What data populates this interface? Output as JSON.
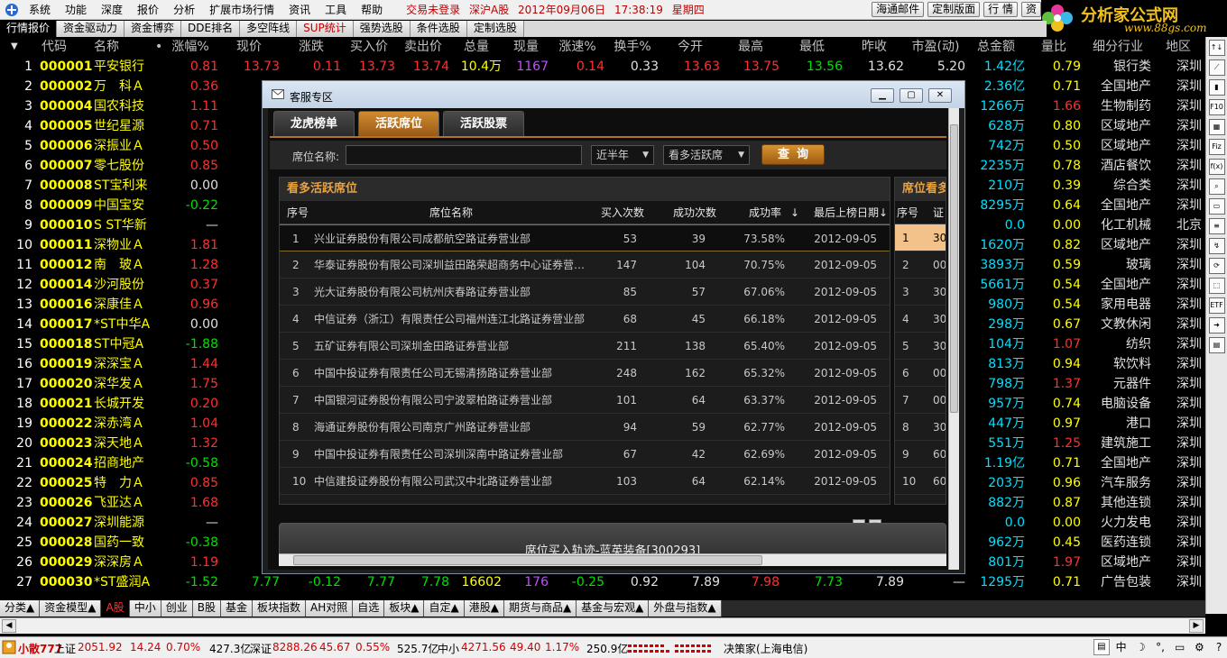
{
  "menubar": {
    "items": [
      "系统",
      "功能",
      "深度",
      "报价",
      "分析",
      "扩展市场行情",
      "资讯",
      "工具",
      "帮助"
    ],
    "status": [
      "交易未登录",
      "深沪A股",
      "2012年09月06日",
      "17:38:19",
      "星期四"
    ],
    "buttons": [
      "海通邮件",
      "定制版面",
      "行 情",
      "资"
    ]
  },
  "brand": {
    "title": "分析家公式网",
    "url": "www.88gs.com"
  },
  "toptabs": [
    {
      "label": "行情报价",
      "state": "active"
    },
    {
      "label": "资金驱动力",
      "state": ""
    },
    {
      "label": "资金博弈",
      "state": ""
    },
    {
      "label": "DDE排名",
      "state": ""
    },
    {
      "label": "多空阵线",
      "state": ""
    },
    {
      "label": "SUP统计",
      "state": "red"
    },
    {
      "label": "强势选股",
      "state": ""
    },
    {
      "label": "条件选股",
      "state": ""
    },
    {
      "label": "定制选股",
      "state": ""
    }
  ],
  "grid": {
    "headers": [
      "代码",
      "名称",
      "•",
      "涨幅%",
      "现价",
      "涨跌",
      "买入价",
      "卖出价",
      "总量",
      "现量",
      "涨速%",
      "换手%",
      "今开",
      "最高",
      "最低",
      "昨收",
      "市盈(动)",
      "总金额",
      "量比",
      "细分行业",
      "地区"
    ],
    "sort_icon": "▼",
    "rows": [
      [
        "1",
        "000001",
        "平安银行",
        "0.81",
        "13.73",
        "0.11",
        "13.73",
        "13.74",
        "10.4万",
        "1167",
        "0.14",
        "0.33",
        "13.63",
        "13.75",
        "13.56",
        "13.62",
        "5.20",
        "1.42亿",
        "0.79",
        "银行类",
        "深圳"
      ],
      [
        "2",
        "000002",
        "万　科Ａ",
        "0.36",
        "8",
        "",
        "",
        "",
        "",
        "",
        "",
        "",
        "",
        "",
        "",
        "",
        "",
        "2.36亿",
        "0.71",
        "全国地产",
        "深圳"
      ],
      [
        "3",
        "000004",
        "国农科技",
        "1.11",
        "8",
        "",
        "",
        "",
        "",
        "",
        "",
        "",
        "",
        "",
        "",
        "",
        "",
        "1266万",
        "1.66",
        "生物制药",
        "深圳"
      ],
      [
        "4",
        "000005",
        "世纪星源",
        "0.71",
        "2",
        "",
        "",
        "",
        "",
        "",
        "",
        "",
        "",
        "",
        "",
        "",
        "",
        "628万",
        "0.80",
        "区域地产",
        "深圳"
      ],
      [
        "5",
        "000006",
        "深振业Ａ",
        "0.50",
        "4",
        "",
        "",
        "",
        "",
        "",
        "",
        "",
        "",
        "",
        "",
        "",
        "",
        "742万",
        "0.50",
        "区域地产",
        "深圳"
      ],
      [
        "6",
        "000007",
        "零七股份",
        "0.85",
        "16",
        "",
        "",
        "",
        "",
        "",
        "",
        "",
        "",
        "",
        "",
        "",
        "",
        "2235万",
        "0.78",
        "酒店餐饮",
        "深圳"
      ],
      [
        "7",
        "000008",
        "ST宝利来",
        "0.00",
        "10",
        "",
        "",
        "",
        "",
        "",
        "",
        "",
        "",
        "",
        "",
        "",
        "",
        "210万",
        "0.39",
        "综合类",
        "深圳"
      ],
      [
        "8",
        "000009",
        "中国宝安",
        "-0.22",
        "8",
        "",
        "",
        "",
        "",
        "",
        "",
        "",
        "",
        "",
        "",
        "",
        "",
        "8295万",
        "0.64",
        "全国地产",
        "深圳"
      ],
      [
        "9",
        "000010",
        "S ST华新",
        "—",
        "",
        "",
        "",
        "",
        "",
        "",
        "",
        "",
        "",
        "",
        "",
        "",
        "",
        "0.0",
        "0.00",
        "化工机械",
        "北京"
      ],
      [
        "10",
        "000011",
        "深物业Ａ",
        "1.81",
        "6",
        "",
        "",
        "",
        "",
        "",
        "",
        "",
        "",
        "",
        "",
        "",
        "",
        "1620万",
        "0.82",
        "区域地产",
        "深圳"
      ],
      [
        "11",
        "000012",
        "南　玻Ａ",
        "1.28",
        "7",
        "",
        "",
        "",
        "",
        "",
        "",
        "",
        "",
        "",
        "",
        "",
        "",
        "3893万",
        "0.59",
        "玻璃",
        "深圳"
      ],
      [
        "12",
        "000014",
        "沙河股份",
        "0.37",
        "8",
        "",
        "",
        "",
        "",
        "",
        "",
        "",
        "",
        "",
        "",
        "",
        "",
        "5661万",
        "0.54",
        "全国地产",
        "深圳"
      ],
      [
        "13",
        "000016",
        "深康佳Ａ",
        "0.96",
        "3",
        "",
        "",
        "",
        "",
        "",
        "",
        "",
        "",
        "",
        "",
        "",
        "",
        "980万",
        "0.54",
        "家用电器",
        "深圳"
      ],
      [
        "14",
        "000017",
        "*ST中华A",
        "0.00",
        "3",
        "",
        "",
        "",
        "",
        "",
        "",
        "",
        "",
        "",
        "",
        "",
        "",
        "298万",
        "0.67",
        "文教休闲",
        "深圳"
      ],
      [
        "15",
        "000018",
        "ST中冠A",
        "-1.88",
        "5",
        "",
        "",
        "",
        "",
        "",
        "",
        "",
        "",
        "",
        "",
        "",
        "",
        "104万",
        "1.07",
        "纺织",
        "深圳"
      ],
      [
        "16",
        "000019",
        "深深宝Ａ",
        "1.44",
        "8",
        "",
        "",
        "",
        "",
        "",
        "",
        "",
        "",
        "",
        "",
        "",
        "",
        "813万",
        "0.94",
        "软饮料",
        "深圳"
      ],
      [
        "17",
        "000020",
        "深华发Ａ",
        "1.75",
        "6",
        "",
        "",
        "",
        "",
        "",
        "",
        "",
        "",
        "",
        "",
        "",
        "",
        "798万",
        "1.37",
        "元器件",
        "深圳"
      ],
      [
        "18",
        "000021",
        "长城开发",
        "0.20",
        "4",
        "",
        "",
        "",
        "",
        "",
        "",
        "",
        "",
        "",
        "",
        "",
        "",
        "957万",
        "0.74",
        "电脑设备",
        "深圳"
      ],
      [
        "19",
        "000022",
        "深赤湾Ａ",
        "1.04",
        "8",
        "",
        "",
        "",
        "",
        "",
        "",
        "",
        "",
        "",
        "",
        "",
        "",
        "447万",
        "0.97",
        "港口",
        "深圳"
      ],
      [
        "20",
        "000023",
        "深天地Ａ",
        "1.32",
        "6",
        "",
        "",
        "",
        "",
        "",
        "",
        "",
        "",
        "",
        "",
        "",
        "",
        "551万",
        "1.25",
        "建筑施工",
        "深圳"
      ],
      [
        "21",
        "000024",
        "招商地产",
        "-0.58",
        "20",
        "",
        "",
        "",
        "",
        "",
        "",
        "",
        "",
        "",
        "",
        "",
        "",
        "1.19亿",
        "0.71",
        "全国地产",
        "深圳"
      ],
      [
        "22",
        "000025",
        "特　力Ａ",
        "0.85",
        "5",
        "",
        "",
        "",
        "",
        "",
        "",
        "",
        "",
        "",
        "",
        "",
        "",
        "203万",
        "0.96",
        "汽车服务",
        "深圳"
      ],
      [
        "23",
        "000026",
        "飞亚达Ａ",
        "1.68",
        "8",
        "",
        "",
        "",
        "",
        "",
        "",
        "",
        "",
        "",
        "",
        "",
        "",
        "882万",
        "0.87",
        "其他连锁",
        "深圳"
      ],
      [
        "24",
        "000027",
        "深圳能源",
        "—",
        "",
        "",
        "",
        "",
        "",
        "",
        "",
        "",
        "",
        "",
        "",
        "",
        "",
        "0.0",
        "0.00",
        "火力发电",
        "深圳"
      ],
      [
        "25",
        "000028",
        "国药一致",
        "-0.38",
        "33",
        "",
        "",
        "",
        "",
        "",
        "",
        "",
        "",
        "",
        "",
        "",
        "",
        "962万",
        "0.45",
        "医药连锁",
        "深圳"
      ],
      [
        "26",
        "000029",
        "深深房Ａ",
        "1.19",
        "3",
        "",
        "",
        "",
        "",
        "",
        "",
        "",
        "",
        "",
        "",
        "",
        "",
        "801万",
        "1.97",
        "区域地产",
        "深圳"
      ],
      [
        "27",
        "000030",
        "*ST盛润A",
        "-1.52",
        "7.77",
        "-0.12",
        "7.77",
        "7.78",
        "16602",
        "176",
        "-0.25",
        "0.92",
        "7.89",
        "7.98",
        "7.73",
        "7.89",
        "—",
        "1295万",
        "0.71",
        "广告包装",
        "深圳"
      ]
    ]
  },
  "righttools": [
    "F10",
    "Fiz",
    "f(x)",
    "ETF"
  ],
  "bottabs": [
    {
      "label": "分类▲",
      "state": ""
    },
    {
      "label": "资金模型▲",
      "state": ""
    },
    {
      "label": "A股",
      "state": "active"
    },
    {
      "label": "中小",
      "state": ""
    },
    {
      "label": "创业",
      "state": ""
    },
    {
      "label": "B股",
      "state": ""
    },
    {
      "label": "基金",
      "state": ""
    },
    {
      "label": "板块指数",
      "state": ""
    },
    {
      "label": "AH对照",
      "state": ""
    },
    {
      "label": "自选",
      "state": ""
    },
    {
      "label": "板块▲",
      "state": ""
    },
    {
      "label": "自定▲",
      "state": ""
    },
    {
      "label": "港股▲",
      "state": ""
    },
    {
      "label": "期货与商品▲",
      "state": ""
    },
    {
      "label": "基金与宏观▲",
      "state": ""
    },
    {
      "label": "外盘与指数▲",
      "state": ""
    }
  ],
  "statusbar": {
    "user": "小散777",
    "sh_label": "上证",
    "sh_val": "2051.92",
    "sh_chg": "14.24",
    "sh_pct": "0.70%",
    "sh_amt": "427.3亿",
    "sz_label": "深证",
    "sz_val": "8288.26",
    "sz_chg": "45.67",
    "sz_pct": "0.55%",
    "sz_amt": "525.7亿",
    "zx_label": "中小",
    "zx_val": "4271.56",
    "zx_chg": "49.40",
    "zx_pct": "1.17%",
    "zx_amt": "250.9亿",
    "server": "决策家(上海电信)",
    "ime": "中"
  },
  "dialog": {
    "title": "客服专区",
    "tabs": [
      {
        "label": "龙虎榜单",
        "state": ""
      },
      {
        "label": "活跃席位",
        "state": "active"
      },
      {
        "label": "活跃股票",
        "state": ""
      }
    ],
    "filter": {
      "label": "席位名称:",
      "placeholder": "",
      "period": "近半年",
      "kind": "看多活跃席",
      "query": "查询"
    },
    "panel_title": "看多活跃席位",
    "columns": [
      "序号",
      "席位名称",
      "买入次数",
      "成功次数",
      "成功率",
      "最后上榜日期"
    ],
    "sort_arrows": [
      "↓",
      "↓"
    ],
    "rows": [
      [
        "1",
        "兴业证券股份有限公司成都航空路证券营业部",
        "53",
        "39",
        "73.58%",
        "2012-09-05"
      ],
      [
        "2",
        "华泰证券股份有限公司深圳益田路荣超商务中心证券营…",
        "147",
        "104",
        "70.75%",
        "2012-09-05"
      ],
      [
        "3",
        "光大证券股份有限公司杭州庆春路证券营业部",
        "85",
        "57",
        "67.06%",
        "2012-09-05"
      ],
      [
        "4",
        "中信证券（浙江）有限责任公司福州连江北路证券营业部",
        "68",
        "45",
        "66.18%",
        "2012-09-05"
      ],
      [
        "5",
        "五矿证券有限公司深圳金田路证券营业部",
        "211",
        "138",
        "65.40%",
        "2012-09-05"
      ],
      [
        "6",
        "中国中投证券有限责任公司无锡清扬路证券营业部",
        "248",
        "162",
        "65.32%",
        "2012-09-05"
      ],
      [
        "7",
        "中国银河证券股份有限公司宁波翠柏路证券营业部",
        "101",
        "64",
        "63.37%",
        "2012-09-05"
      ],
      [
        "8",
        "海通证券股份有限公司南京广州路证券营业部",
        "94",
        "59",
        "62.77%",
        "2012-09-05"
      ],
      [
        "9",
        "中国中投证券有限责任公司深圳深南中路证券营业部",
        "67",
        "42",
        "62.69%",
        "2012-09-05"
      ],
      [
        "10",
        "中信建投证券股份有限公司武汉中北路证券营业部",
        "103",
        "64",
        "62.14%",
        "2012-09-05"
      ]
    ],
    "panel2_title": "席位看多",
    "panel2_headers": [
      "序号",
      "证"
    ],
    "panel2_rows": [
      [
        "1",
        "30"
      ],
      [
        "2",
        "00"
      ],
      [
        "3",
        "30"
      ],
      [
        "4",
        "30"
      ],
      [
        "5",
        "30"
      ],
      [
        "6",
        "00"
      ],
      [
        "7",
        "00"
      ],
      [
        "8",
        "30"
      ],
      [
        "9",
        "60"
      ],
      [
        "10",
        "60"
      ]
    ],
    "track_label": "席位买入轨迹-蓝英装备[300293]"
  }
}
